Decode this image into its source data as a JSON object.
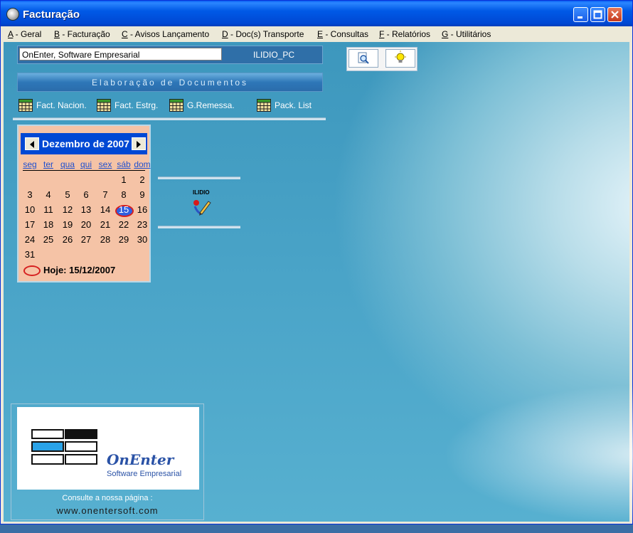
{
  "window": {
    "title": "Facturação"
  },
  "menu": [
    {
      "key": "A",
      "rest": " - Geral"
    },
    {
      "key": "B",
      "rest": " - Facturação"
    },
    {
      "key": "C",
      "rest": " - Avisos Lançamento"
    },
    {
      "key": "D",
      "rest": " - Doc(s) Transporte"
    },
    {
      "key": "E",
      "rest": " - Consultas"
    },
    {
      "key": "F",
      "rest": " - Relatórios"
    },
    {
      "key": "G",
      "rest": " - Utilitários"
    }
  ],
  "company": {
    "name": "OnEnter, Software Empresarial",
    "pc": "ILIDIO_PC"
  },
  "banner": {
    "title": "Elaboração de Documentos"
  },
  "quick_links": [
    "Fact. Nacion.",
    "Fact. Estrg.",
    "G.Remessa.",
    "Pack. List"
  ],
  "calendar": {
    "title": "Dezembro de 2007",
    "weekdays": [
      "seg",
      "ter",
      "qua",
      "qui",
      "sex",
      "sáb",
      "dom"
    ],
    "weeks": [
      [
        "",
        "",
        "",
        "",
        "",
        "1",
        "2"
      ],
      [
        "3",
        "4",
        "5",
        "6",
        "7",
        "8",
        "9"
      ],
      [
        "10",
        "11",
        "12",
        "13",
        "14",
        "15",
        "16"
      ],
      [
        "17",
        "18",
        "19",
        "20",
        "21",
        "22",
        "23"
      ],
      [
        "24",
        "25",
        "26",
        "27",
        "28",
        "29",
        "30"
      ],
      [
        "31",
        "",
        "",
        "",
        "",
        "",
        ""
      ]
    ],
    "today_day": "15",
    "today_label": "Hoje: 15/12/2007"
  },
  "user_tile": {
    "name": "ILIDIO",
    "icon": "user-edit-icon"
  },
  "logo": {
    "brand": "OnEnter",
    "subtitle": "Software Empresarial",
    "visit": "Consulte a nossa página :",
    "url": "www.onentersoft.com"
  },
  "colors": {
    "title_bar": "#0048d4",
    "calendar_bg": "#f5c3a6",
    "today_ring": "#d62020",
    "desktop": "#4aa4c8"
  }
}
